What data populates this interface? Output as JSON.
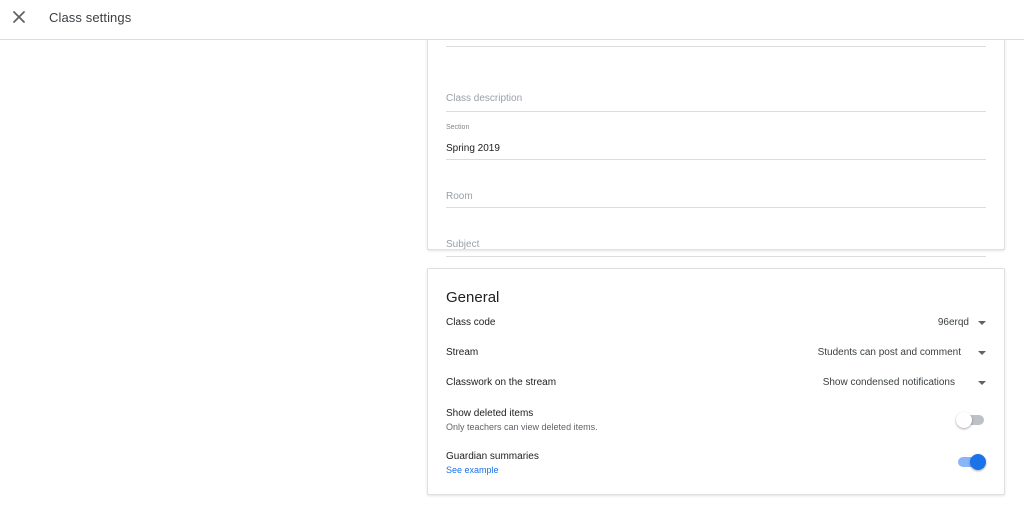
{
  "header": {
    "title": "Class settings"
  },
  "class_details": {
    "name_value_partial": "",
    "description_placeholder": "Class description",
    "section_label": "Section",
    "section_value": "Spring 2019",
    "room_placeholder": "Room",
    "subject_placeholder": "Subject"
  },
  "general": {
    "heading": "General",
    "class_code": {
      "label": "Class code",
      "value": "96erqd"
    },
    "stream": {
      "label": "Stream",
      "value": "Students can post and comment"
    },
    "classwork": {
      "label": "Classwork on the stream",
      "value": "Show condensed notifications"
    },
    "deleted_items": {
      "label": "Show deleted items",
      "sub": "Only teachers can view deleted items.",
      "enabled": false
    },
    "guardian": {
      "label": "Guardian summaries",
      "link": "See example",
      "enabled": true
    }
  },
  "colors": {
    "accent": "#1a73e8",
    "toggle_on_track": "#8ab4f8",
    "toggle_off_track": "#bdc1c6"
  },
  "icons": {
    "close": "close-icon",
    "dropdown": "caret-down-icon"
  }
}
